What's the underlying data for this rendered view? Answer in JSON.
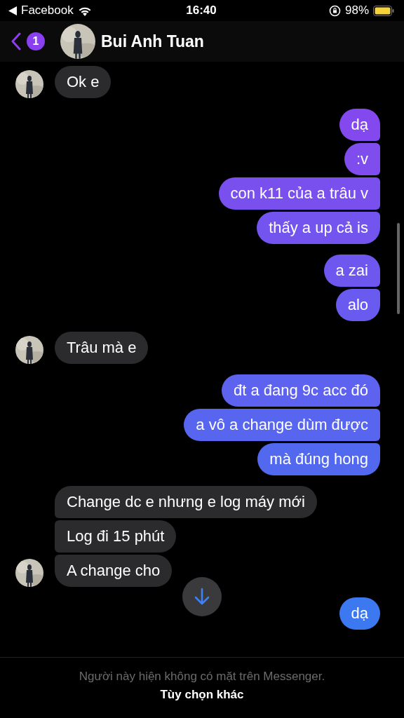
{
  "status_bar": {
    "back_app": "Facebook",
    "time": "16:40",
    "battery": "98%"
  },
  "header": {
    "badge": "1",
    "name": "Bui Anh Tuan"
  },
  "groups": [
    {
      "kind": "received",
      "texts": [
        "Ok e"
      ]
    },
    {
      "kind": "sent",
      "texts": [
        "dạ",
        ":v",
        "con k11 của a trâu v",
        "thấy a up cả is"
      ]
    },
    {
      "kind": "sent",
      "texts": [
        "a zai",
        "alo"
      ]
    },
    {
      "kind": "received",
      "texts": [
        "Trâu mà e"
      ]
    },
    {
      "kind": "sent",
      "texts": [
        "đt a đang 9c acc đó",
        "a vô a change dùm được",
        "mà đúng hong"
      ]
    },
    {
      "kind": "received",
      "texts": [
        "Change dc e nhưng e log máy mới",
        "Log đi 15 phút",
        "A change cho"
      ]
    },
    {
      "kind": "sent",
      "texts": [
        "dạ"
      ]
    }
  ],
  "footer": {
    "notice": "Người này hiện không có mặt trên Messenger.",
    "link": "Tùy chọn khác"
  }
}
